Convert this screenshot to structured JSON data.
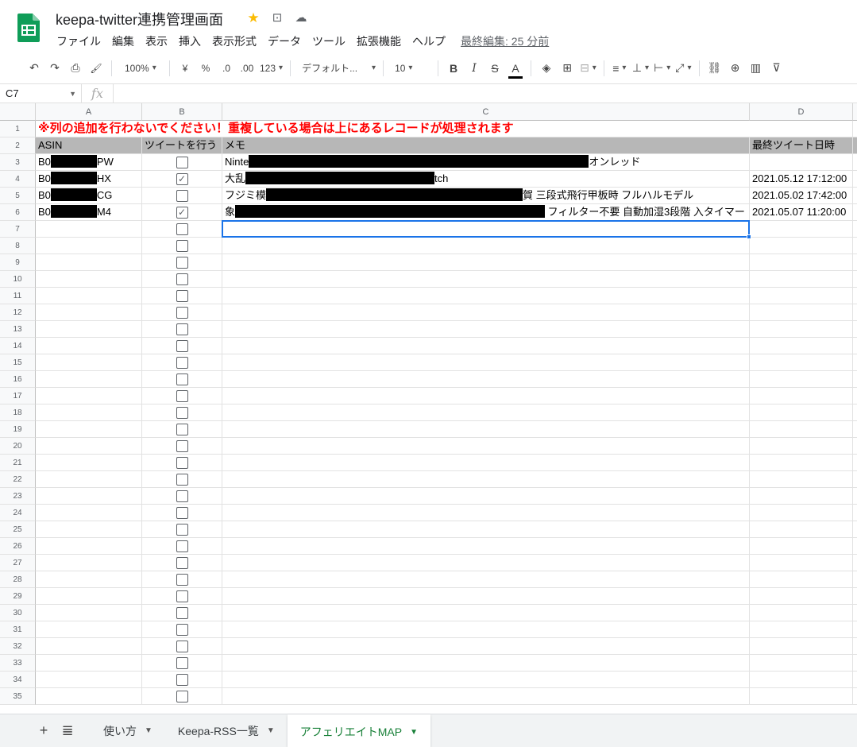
{
  "doc": {
    "title": "keepa-twitter連携管理画面",
    "star_icon": "star-icon",
    "move_icon": "folder-move-icon",
    "cloud_icon": "cloud-status-icon"
  },
  "menu": {
    "items": [
      "ファイル",
      "編集",
      "表示",
      "挿入",
      "表示形式",
      "データ",
      "ツール",
      "拡張機能",
      "ヘルプ"
    ],
    "last_edit": "最終編集: 25 分前"
  },
  "toolbar": {
    "undo": "↶",
    "redo": "↷",
    "print": "⎙",
    "paint_format": "🖌",
    "zoom": "100%",
    "currency": "¥",
    "percent": "%",
    "decimal_decrease": ".0",
    "decimal_increase": ".00",
    "more_formats": "123",
    "font": "デフォルト...",
    "font_size": "10",
    "bold": "B",
    "italic": "I",
    "strike": "S",
    "text_color": "A",
    "fill": "◈",
    "borders": "⊞",
    "merge": "⊟",
    "halign": "≡",
    "valign": "⊥",
    "wrap": "⊢",
    "rotate": "⤢",
    "link": "⛓",
    "comment": "⊕",
    "chart": "▥",
    "filter": "⊽"
  },
  "formula_bar": {
    "name_box": "C7",
    "fx": "fx",
    "value": ""
  },
  "columns": [
    "A",
    "B",
    "C",
    "D"
  ],
  "rows": [
    "1",
    "2",
    "3",
    "4",
    "5",
    "6",
    "7",
    "8",
    "9",
    "10",
    "11",
    "12",
    "13",
    "14",
    "15",
    "16",
    "17",
    "18",
    "19",
    "20",
    "21",
    "22",
    "23",
    "24",
    "25",
    "26",
    "27",
    "28",
    "29",
    "30",
    "31",
    "32",
    "33",
    "34",
    "35"
  ],
  "sheet": {
    "notice": "※列の追加を行わないでください！重複している場合は上にあるレコードが処理されます",
    "headers": {
      "asin": "ASIN",
      "tweet": "ツイートを行う",
      "memo": "メモ",
      "last_tweet": "最終ツイート日時"
    },
    "records": [
      {
        "asin_prefix": "B0",
        "asin_suffix": "PW",
        "checked": false,
        "memo_prefix": "Ninte",
        "memo_suffix": "オンレッド",
        "last_tweet": ""
      },
      {
        "asin_prefix": "B0",
        "asin_suffix": "HX",
        "checked": true,
        "memo_prefix": "大乱",
        "memo_suffix": "tch",
        "last_tweet": "2021.05.12 17:12:00"
      },
      {
        "asin_prefix": "B0",
        "asin_suffix": "CG",
        "checked": false,
        "memo_prefix": "フジミ模",
        "memo_suffix": "賀 三段式飛行甲板時 フルハルモデル",
        "last_tweet": "2021.05.02 17:42:00"
      },
      {
        "asin_prefix": "B0",
        "asin_suffix": "M4",
        "checked": true,
        "memo_prefix": "象",
        "memo_suffix": " フィルター不要 自動加湿3段階 入タイマー",
        "last_tweet": "2021.05.07 11:20:00"
      }
    ]
  },
  "tabs": {
    "add": "+",
    "list": "≣",
    "items": [
      {
        "label": "使い方",
        "active": false
      },
      {
        "label": "Keepa-RSS一覧",
        "active": false
      },
      {
        "label": "アフェリエイトMAP",
        "active": true
      }
    ]
  },
  "colors": {
    "accent": "#1a73e8",
    "notice": "#ff0000",
    "header_fill": "#b7b7b7",
    "active_tab": "#188038"
  }
}
